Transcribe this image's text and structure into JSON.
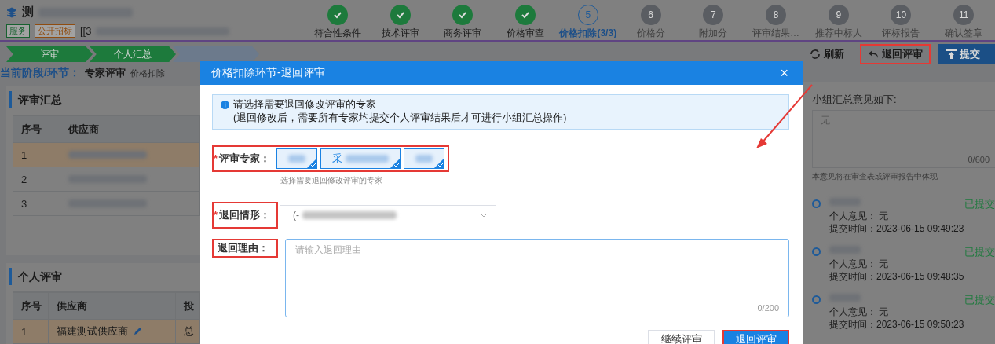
{
  "header": {
    "title": "测",
    "tags": [
      {
        "label": "服务",
        "color": "#17612f"
      },
      {
        "label": "公开招标",
        "color": "#8f4c10"
      }
    ],
    "code": "[[3"
  },
  "steps": [
    {
      "label": "符合性条件",
      "done": true,
      "selected": false
    },
    {
      "label": "技术评审",
      "done": true,
      "selected": false
    },
    {
      "label": "商务评审",
      "done": true,
      "selected": false
    },
    {
      "label": "价格审查",
      "done": true,
      "selected": false
    },
    {
      "number": "5",
      "label": "价格扣除(3/3)",
      "done": false,
      "selected": true
    },
    {
      "number": "6",
      "label": "价格分",
      "done": false,
      "selected": false
    },
    {
      "number": "7",
      "label": "附加分",
      "done": false,
      "selected": false
    },
    {
      "number": "8",
      "label": "评审结果…",
      "done": false,
      "selected": false
    },
    {
      "number": "9",
      "label": "推荐中标人",
      "done": false,
      "selected": false
    },
    {
      "number": "10",
      "label": "评标报告",
      "done": false,
      "selected": false
    },
    {
      "number": "11",
      "label": "确认签章",
      "done": false,
      "selected": false
    }
  ],
  "flow": [
    {
      "label": "评审",
      "done": true
    },
    {
      "label": "个人汇总",
      "done": true
    },
    {
      "done": false
    }
  ],
  "toolbar": [
    {
      "kind": "refresh",
      "label": "刷新",
      "highlighted": false
    },
    {
      "kind": "return",
      "label": "退回评审",
      "highlighted": true
    },
    {
      "kind": "submit",
      "label": "提交",
      "highlighted": false
    }
  ],
  "phase": {
    "label": "当前阶段/环节：",
    "stage": "专家评审",
    "step": "价格扣除"
  },
  "summary": {
    "title": "评审汇总",
    "columns": [
      "序号",
      "供应商"
    ],
    "rows": [
      {
        "index": "1",
        "selected": true
      },
      {
        "index": "2",
        "selected": false
      },
      {
        "index": "3",
        "selected": false
      }
    ]
  },
  "personal": {
    "title": "个人评审",
    "columns": [
      "序号",
      "供应商",
      "投"
    ],
    "rows": [
      {
        "index": "1",
        "supplier": "福建测试供应商",
        "column_3": "总",
        "selected": true
      }
    ]
  },
  "opinion": {
    "label": "小组汇总意见如下:",
    "placeholder": "无",
    "counter": "0/600",
    "note": "本意见将在审查表或评审报告中体现",
    "entries": [
      {
        "status": "已提交",
        "opinion_label": "个人意见：",
        "opinion": "无",
        "time_label": "提交时间：",
        "time": "2023-06-15 09:49:23"
      },
      {
        "status": "已提交",
        "opinion_label": "个人意见：",
        "opinion": "无",
        "time_label": "提交时间：",
        "time": "2023-06-15 09:48:35"
      },
      {
        "status": "已提交",
        "opinion_label": "个人意见：",
        "opinion": "无",
        "time_label": "提交时间：",
        "time": "2023-06-15 09:50:23"
      }
    ]
  },
  "dialog": {
    "title": "价格扣除环节-退回评审",
    "close": "×",
    "alert": {
      "title": "请选择需要退回修改评审的专家",
      "text": "(退回修改后，需要所有专家均提交个人评审结果后才可进行小组汇总操作)"
    },
    "fields": [
      {
        "kind": "experts",
        "label": "评审专家：",
        "required_mark": "*",
        "highlighted": true,
        "hint": "选择需要退回修改评审的专家",
        "options": [
          {
            "checked": true
          },
          {
            "label": "采",
            "checked": true
          },
          {
            "checked": true
          }
        ]
      },
      {
        "kind": "select",
        "label": "退回情形：",
        "required_mark": "*",
        "highlighted": true,
        "value": "(-"
      },
      {
        "kind": "textarea",
        "label": "退回理由：",
        "highlighted": true,
        "placeholder": "请输入退回理由",
        "counter": "0/200"
      }
    ],
    "buttons": [
      {
        "label": "继续评审",
        "primary": false,
        "highlighted": false
      },
      {
        "label": "退回评审",
        "primary": true,
        "highlighted": true
      }
    ]
  }
}
